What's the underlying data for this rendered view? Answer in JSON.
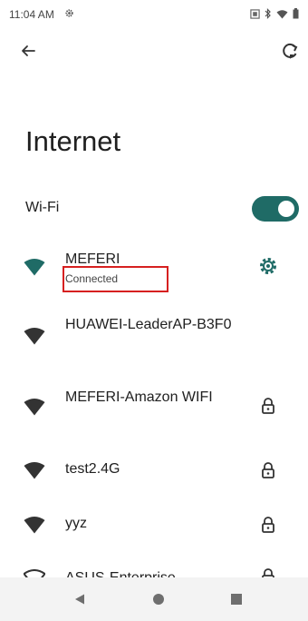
{
  "status_bar": {
    "time": "11:04 AM",
    "left_icons": [
      "gear-icon"
    ],
    "right_icons": [
      "screenshot-icon",
      "bluetooth-icon",
      "wifi-icon",
      "battery-icon"
    ]
  },
  "toolbar": {
    "back_icon": "arrow-left-icon",
    "reset_icon": "network-reset-icon"
  },
  "page": {
    "title": "Internet"
  },
  "wifi": {
    "label": "Wi-Fi",
    "enabled": true
  },
  "networks": [
    {
      "name": "MEFERI",
      "status": "Connected",
      "action_icon": "gear-icon",
      "connected": true
    },
    {
      "name": "HUAWEI-LeaderAP-B3F0",
      "status": "",
      "action_icon": "",
      "connected": false
    },
    {
      "name": "MEFERI-Amazon WIFI",
      "status": "",
      "action_icon": "lock-icon",
      "connected": false
    },
    {
      "name": "test2.4G",
      "status": "",
      "action_icon": "lock-icon",
      "connected": false
    },
    {
      "name": "yyz",
      "status": "",
      "action_icon": "lock-icon",
      "connected": false
    },
    {
      "name": "ASUS-Enterprise",
      "status": "",
      "action_icon": "lock-icon",
      "connected": false
    }
  ],
  "colors": {
    "accent": "#1f6b66",
    "highlight": "#d62020",
    "text": "#202020"
  }
}
